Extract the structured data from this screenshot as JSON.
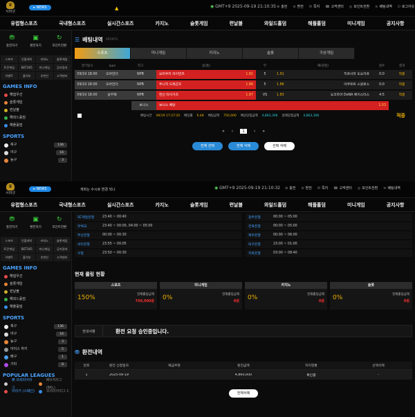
{
  "header": {
    "logo_text": "서퍼넷",
    "news_label": "NEWS",
    "gmt1": "GMT+9 2025-09-19 21:10:35",
    "gmt2": "GMT+9 2025-09-19 21:10:32",
    "marquee": "계좌는 수시로 변경 되니",
    "links": [
      "충전",
      "환전",
      "쪽지",
      "고객센터",
      "포인트전환",
      "베팅내역",
      "로그아웃"
    ]
  },
  "nav": [
    "유럽형스포츠",
    "국내형스포츠",
    "실시간스포츠",
    "카지노",
    "슬롯게임",
    "련날볼",
    "와일드홀덤",
    "해플홀덤",
    "미니게임",
    "공지사항"
  ],
  "quick": [
    "충전하기",
    "환전하기",
    "포인트전환"
  ],
  "grid1": [
    "스포츠",
    "인플레이",
    "카지노",
    "슬롯게임",
    "토큰게임",
    "BET365",
    "미니게임",
    "공지경과",
    "이벤트",
    "출석부",
    "추천인",
    "고객센터"
  ],
  "games_title": "GAMES INFO",
  "games": [
    {
      "name": "해썹우선",
      "color": "#e84a4a"
    },
    {
      "name": "슬롯게임",
      "color": "#e8863a"
    },
    {
      "name": "련날볼",
      "color": "#d1b12a"
    },
    {
      "name": "해외느홀덤",
      "color": "#3ab14a"
    },
    {
      "name": "해플홀덤",
      "color": "#3a8ee8"
    }
  ],
  "sports_title": "SPORTS",
  "sports": [
    {
      "name": "축구",
      "count": "136",
      "color": "#eee"
    },
    {
      "name": "야구",
      "count": "16",
      "color": "#ddd"
    },
    {
      "name": "농구",
      "count": "3",
      "color": "#e8863a"
    },
    {
      "name": "아이스 하키",
      "count": "5",
      "color": "#999"
    },
    {
      "name": "배구",
      "count": "1",
      "color": "#4a9ee8"
    },
    {
      "name": "기타",
      "count": "8",
      "color": "#b04ae8"
    }
  ],
  "leagues_title": "POPULAR LEAGUES",
  "leagues": [
    {
      "a": "英 프레미어리그",
      "b": "베이지리그 (BKL)"
    },
    {
      "a": "라리가 (스페인)",
      "b": "프리미어리그 1"
    }
  ],
  "bet": {
    "title": "베팅내역",
    "sub": "SPORTS",
    "tabs": [
      "스포츠",
      "미니게임",
      "카지노",
      "슬롯",
      "가상게임"
    ],
    "cols": [
      "경기일시",
      "Type",
      "리그",
      "승(홈)",
      "무",
      "패(원정)",
      "점수",
      "결과"
    ],
    "rows": [
      {
        "date": "09/19 18:00",
        "type": "오버언더",
        "league": "NPB",
        "home": "요미우리 자이언츠",
        "h_odd": "1.81",
        "mid": "5",
        "d_odd": "1.91",
        "away": "히로시마 도요카프",
        "score": "0:0",
        "result": "적중"
      },
      {
        "date": "09/19 18:00",
        "type": "오버언더",
        "league": "NPB",
        "home": "주니치 드래곤즈",
        "h_odd": "1.86",
        "mid": "5",
        "d_odd": "1.86",
        "away": "야쿠르트 스왈로스",
        "score": "0:0",
        "result": "적중"
      },
      {
        "date": "09/19 18:00",
        "type": "승무패",
        "league": "NPB",
        "home": "한신 타이거즈",
        "h_odd": "1.87",
        "mid": "VS",
        "d_odd": "1.83",
        "away": "요코하마 DeNA 베이스타스",
        "score": "4:5",
        "result": "적중"
      }
    ],
    "bonus_label": "보너스",
    "bonus_name": "보너스 배당",
    "bonus_odd": "1.03",
    "info": {
      "time_l": "베팅시간",
      "time": "09/19 17:27:20",
      "odds_l": "배당률",
      "odds": "6.48",
      "amt_l": "베팅금액",
      "amt": "750,000",
      "exp_l": "예상당첨금액",
      "exp": "4,863,306",
      "real_l": "실제당첨금액",
      "real": "4,863,306",
      "result": "적중"
    },
    "page": "1",
    "btns": [
      "전체 선택",
      "전체 삭제",
      "선택 삭제"
    ]
  },
  "banks": [
    [
      "SC제일은행",
      "23:40 ~ 00:40"
    ],
    [
      "광주은행",
      "00:00 ~ 05:00"
    ],
    [
      "우체국",
      "23:40 ~ 00:00, 04:00 ~ 05:00"
    ],
    [
      "전북은행",
      "00:00 ~ 05:00"
    ],
    [
      "부산은행",
      "00:00 ~ 00:30"
    ],
    [
      "제주은행",
      "00:00 ~ 06:00"
    ],
    [
      "씨티은행",
      "23:55 ~ 00:05"
    ],
    [
      "대구은행",
      "23:00 ~ 01:00"
    ],
    [
      "수협",
      "23:50 ~ 00:30"
    ],
    [
      "저축은행",
      "03:00 ~ 08:40"
    ]
  ],
  "rolling": {
    "title": "현재 롤링 현황",
    "boxes": [
      {
        "h": "스포츠",
        "pct": "150%",
        "l": "현재롤링금액",
        "v": "750,000원"
      },
      {
        "h": "미니게임",
        "pct": "0%",
        "l": "현재롤링금액",
        "v": "0원"
      },
      {
        "h": "카지노",
        "pct": "0%",
        "l": "현재롤링금액",
        "v": "0원"
      },
      {
        "h": "슬롯",
        "pct": "0%",
        "l": "현재롤링금액",
        "v": "0원"
      }
    ]
  },
  "notice": {
    "label": "안내사항",
    "msg": "환전 요청 승인중입니다."
  },
  "exchange": {
    "title": "환전내역",
    "cols": [
      "번호",
      "환전 신청일자",
      "예금주명",
      "환전금액",
      "처리현황",
      "선택삭제"
    ],
    "row": {
      "no": "1",
      "date": "2025-09-19",
      "name": "",
      "amount": "4,860,000",
      "status": "확인중",
      "del": "-"
    },
    "btn": "전체삭제"
  }
}
